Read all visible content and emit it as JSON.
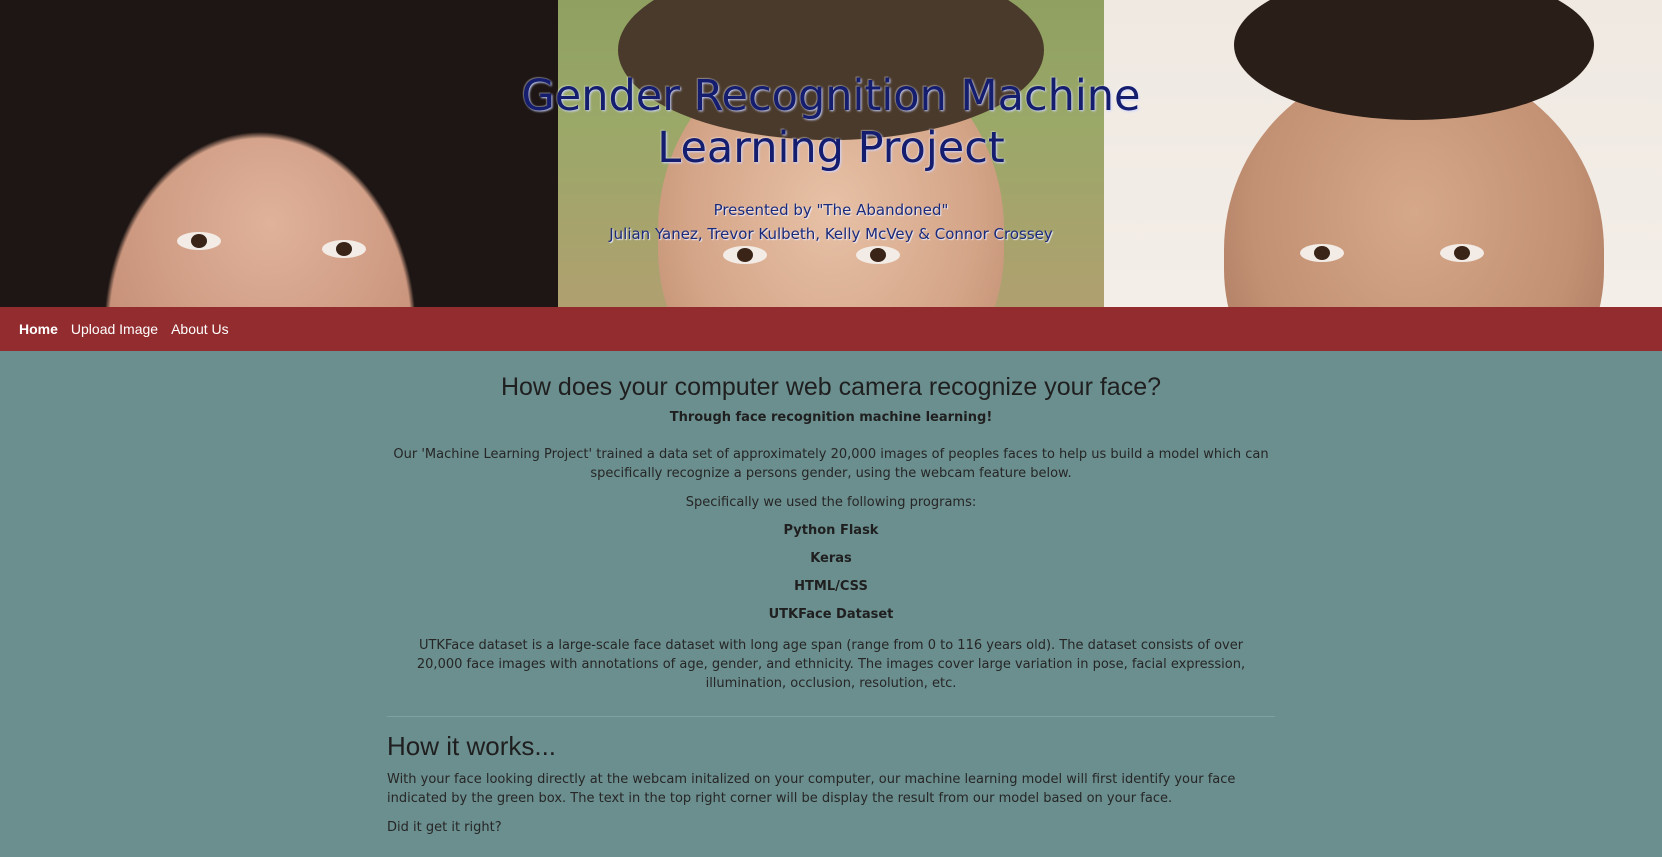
{
  "hero": {
    "title": "Gender Recognition Machine Learning Project",
    "presented_by": "Presented by \"The Abandoned\"",
    "authors": "Julian Yanez, Trevor Kulbeth, Kelly McVey & Connor Crossey"
  },
  "nav": {
    "items": [
      {
        "label": "Home",
        "active": true
      },
      {
        "label": "Upload Image",
        "active": false
      },
      {
        "label": "About Us",
        "active": false
      }
    ]
  },
  "main": {
    "heading": "How does your computer web camera recognize your face?",
    "lead": "Through face recognition machine learning!",
    "description": "Our 'Machine Learning Project' trained a data set of approximately 20,000 images of peoples faces to help us build a model which can specifically recognize a persons gender, using the webcam feature below.",
    "programs_intro": "Specifically we used the following programs:",
    "programs": [
      "Python Flask",
      "Keras",
      "HTML/CSS",
      "UTKFace Dataset"
    ],
    "utk_description": "UTKFace dataset is a large-scale face dataset with long age span (range from 0 to 116 years old). The dataset consists of over 20,000 face images with annotations of age, gender, and ethnicity. The images cover large variation in pose, facial expression, illumination, occlusion, resolution, etc."
  },
  "how_it_works": {
    "heading": "How it works...",
    "text": "With your face looking directly at the webcam initalized on your computer, our machine learning model will first identify your face indicated by the green box. The text in the top right corner will be display the result from our model based on your face.",
    "question": "Did it get it right?"
  },
  "colors": {
    "nav_background": "#922c2e",
    "page_background": "#6b8e8e",
    "title_color": "#141d6e"
  }
}
